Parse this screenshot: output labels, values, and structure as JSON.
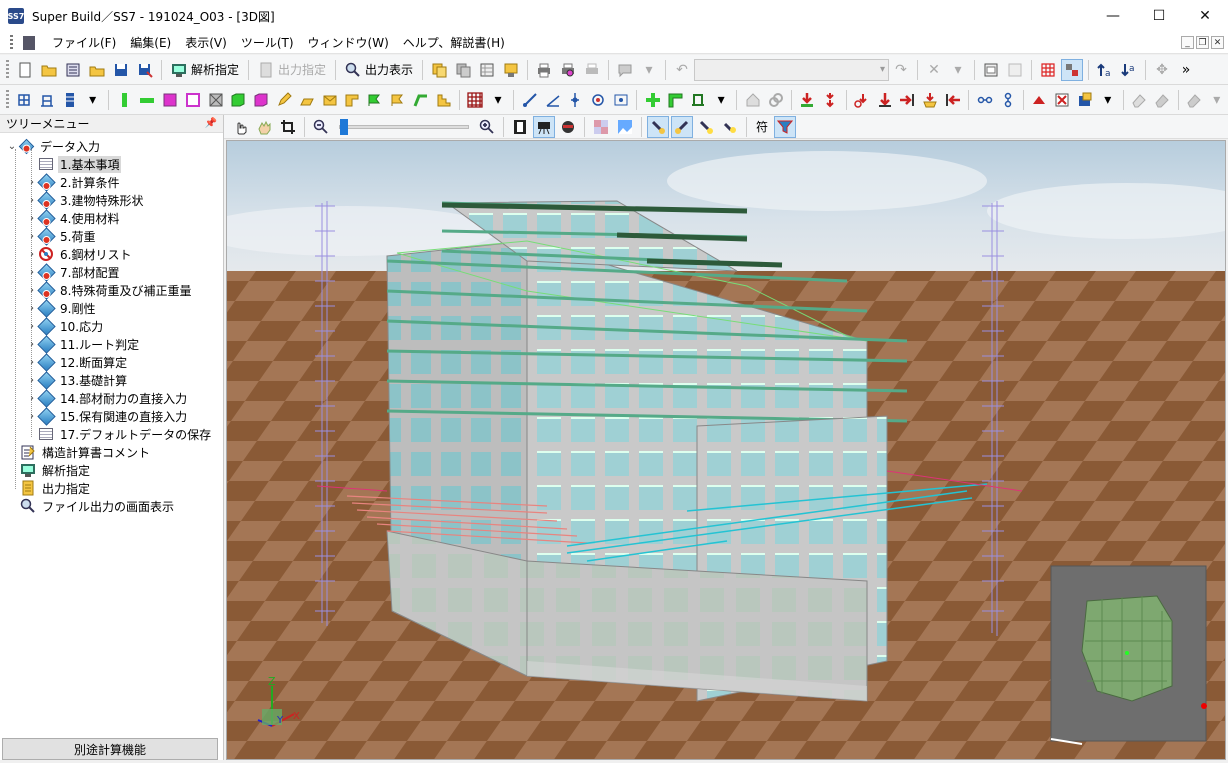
{
  "window": {
    "title": "Super Build／SS7 - 191024_O03 - [3D図]",
    "app_icon_text": "SS7",
    "minimize": "—",
    "maximize": "☐",
    "close": "✕"
  },
  "menu": {
    "items": [
      "ファイル(F)",
      "編集(E)",
      "表示(V)",
      "ツール(T)",
      "ウィンドウ(W)",
      "ヘルプ、解説書(H)"
    ]
  },
  "toolbar1": {
    "analysis_label": "解析指定",
    "output_spec_label": "出力指定",
    "output_display_label": "出力表示",
    "combo_value": ""
  },
  "tree": {
    "header": "ツリーメニュー",
    "root_label": "データ入力",
    "items": [
      {
        "label": "1.基本事項",
        "icon": "document-icon",
        "selected": true
      },
      {
        "label": "2.計算条件",
        "icon": "diamond-alert-icon"
      },
      {
        "label": "3.建物特殊形状",
        "icon": "diamond-alert-icon"
      },
      {
        "label": "4.使用材料",
        "icon": "diamond-alert-icon"
      },
      {
        "label": "5.荷重",
        "icon": "diamond-alert-icon"
      },
      {
        "label": "6.鋼材リスト",
        "icon": "prohibited-icon"
      },
      {
        "label": "7.部材配置",
        "icon": "diamond-alert-icon"
      },
      {
        "label": "8.特殊荷重及び補正重量",
        "icon": "diamond-alert-icon"
      },
      {
        "label": "9.剛性",
        "icon": "diamond-icon"
      },
      {
        "label": "10.応力",
        "icon": "diamond-icon"
      },
      {
        "label": "11.ルート判定",
        "icon": "diamond-icon"
      },
      {
        "label": "12.断面算定",
        "icon": "diamond-icon"
      },
      {
        "label": "13.基礎計算",
        "icon": "diamond-icon"
      },
      {
        "label": "14.部材耐力の直接入力",
        "icon": "diamond-icon"
      },
      {
        "label": "15.保有関連の直接入力",
        "icon": "diamond-icon"
      },
      {
        "label": "17.デフォルトデータの保存",
        "icon": "document-icon"
      }
    ],
    "other_items": [
      {
        "label": "構造計算書コメント"
      },
      {
        "label": "解析指定"
      },
      {
        "label": "出力指定"
      },
      {
        "label": "ファイル出力の画面表示"
      }
    ],
    "bottom_button": "別途計算機能"
  },
  "view_toolbar": {
    "mark_label": "符"
  },
  "viewport": {
    "axis_labels": [
      "Z",
      "Y",
      "X"
    ]
  },
  "colors": {
    "accent": "#1e78d7",
    "ground": "#8a5a36",
    "sky_top": "#c7d9e6",
    "glass": "#a8d8dc",
    "concrete": "#c8c8c8"
  }
}
